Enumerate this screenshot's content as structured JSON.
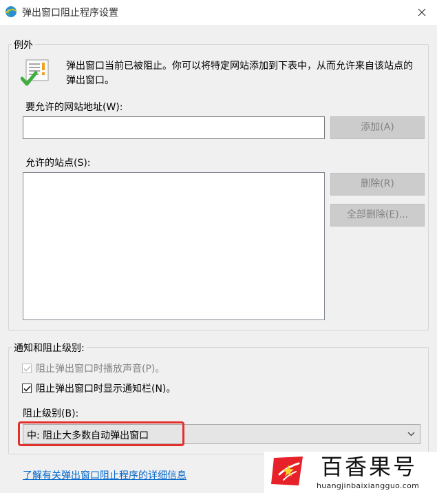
{
  "window": {
    "title": "弹出窗口阻止程序设置",
    "app_icon": "ie-globe-icon",
    "close_icon": "close-icon"
  },
  "exceptions": {
    "group_title": "例外",
    "icon": "exception-checklist-icon",
    "description": "弹出窗口当前已被阻止。你可以将特定网站添加到下表中，从而允许来自该站点的弹出窗口。",
    "address_label": "要允许的网站地址(W):",
    "address_value": "",
    "add_button": "添加(A)",
    "allowed_label": "允许的站点(S):",
    "allowed_sites": [],
    "remove_button": "删除(R)",
    "remove_all_button": "全部删除(E)..."
  },
  "notifications": {
    "group_title": "通知和阻止级别:",
    "play_sound_label": "阻止弹出窗口时播放声音(P)。",
    "play_sound_checked": true,
    "show_bar_label": "阻止弹出窗口时显示通知栏(N)。",
    "show_bar_checked": true,
    "level_label": "阻止级别(B):",
    "level_value": "中: 阻止大多数自动弹出窗口"
  },
  "help_link": "了解有关弹出窗口阻止程序的详细信息",
  "watermark": {
    "title": "百香果号",
    "subtitle": "huangjinbaixiangguo.com"
  },
  "colors": {
    "highlight": "#e4302b",
    "link": "#0066cc",
    "disabled_button": "#cccccc",
    "window_bg": "#f0f0f0"
  }
}
